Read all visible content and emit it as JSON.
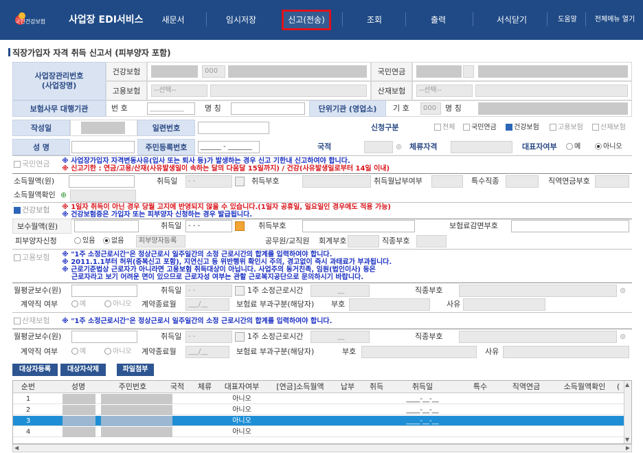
{
  "header": {
    "logo_text": "국민건강보험",
    "app_title": "사업장 EDI서비스",
    "nav": {
      "new_doc": "새문서",
      "temp_save": "임시저장",
      "submit": "신고(전송)",
      "lookup": "조회",
      "print": "출력",
      "close_form": "서식닫기",
      "help": "도움말",
      "all_menu": "전체메뉴 열기"
    }
  },
  "page": {
    "title": "직장가입자 자격 취득 신고서 (피부양자 포함)"
  },
  "form": {
    "biz_no_label": "사업장관리번호\n(사업장명)",
    "health_label": "건강보험",
    "employ_label": "고용보험",
    "pension_label": "국민연금",
    "accident_label": "산재보험",
    "code_000": "000",
    "select_placeholder": "--선택--",
    "agency_label": "보험사무 대행기관",
    "no_label": "번 호",
    "name_label": "명 칭",
    "agency_no_placeholder": "__________",
    "unit_label": "단위기관 (영업소)",
    "symbol_label": "기 호",
    "date_label": "작성일",
    "serial_label": "일련번호",
    "apply_label": "신청구분",
    "apply_all": "전체",
    "apply_pension": "국민연금",
    "apply_health": "건강보험",
    "apply_employ": "고용보험",
    "apply_accident": "산재보험",
    "person_name_label": "성 명",
    "rrn_label": "주민등록번호",
    "rrn_placeholder": "______ - _______",
    "nationality_label": "국적",
    "stay_label": "체류자격",
    "rep_label": "대표자여부",
    "yes": "예",
    "no": "아니오"
  },
  "pension": {
    "section_label": "국민연금",
    "warn1": "※ 사업장가입자 자격변동사유(입사 또는 퇴사 등)가 발생하는 경우 신고 기한내 신고하여야 합니다.",
    "warn2": "※ 신고기한 : 연금/고용/산재(사유발생일이 속하는 달의 다음달 15일까지) / 건강(사유발생일로부터 14일 이내)",
    "income_label": "소득월액(원)",
    "acq_date_label": "취득일",
    "acq_date_placeholder": "- -",
    "acq_code_label": "취득부호",
    "monthly_pay_label": "취득월납부여부",
    "special_label": "특수직종",
    "job_pension_label": "직역연금부호",
    "income_check_label": "소득월액확인"
  },
  "health": {
    "section_label": "건강보험",
    "warn1": "※ 1일자 취득이 아닌 경우 당월 고지에 반영되지 않을 수 있습니다.(1일자 공휴일, 일요일인 경우에도 적용 가능)",
    "warn2": "※ 건강보험증은 가입자 또는 피부양자 신청하는 경우 발급됩니다.",
    "pay_label": "보수월액(원)",
    "acq_date_label": "취득일",
    "acq_date_placeholder": "- - -",
    "acq_code_label": "취득부호",
    "reduce_label": "보험료감면부호",
    "dependent_label": "피부양자신청",
    "dep_yes": "있음",
    "dep_no": "없음",
    "dep_register": "피부양자등록",
    "official_label": "공무원/교직원",
    "account_label": "회계부호",
    "job_label": "직종부호"
  },
  "employ": {
    "section_label": "고용보험",
    "warn1": "※ \"1주 소정근로시간\"은 정상근로시 일주일간의 소정 근로시간의 합계를 입력하여야 합니다.",
    "warn2": "※ 2011.1.1부터 허위(중복신고 포함), 지연신고 등 위반행위 확인시 주의, 경고없이 즉시 과태료가 부과됩니다.",
    "warn3": "※ 근로기준법상 근로자가 아니라면 고용보험 취득대상이 아닙니다. 사업주의 동거친족, 임원(법인이사) 등은",
    "warn4": "근로자라고 보기 어려운 면이 있으므로 근로자성 여부는 관할 근로복지공단으로 문의하시기 바랍니다.",
    "avg_pay_label": "월평균보수(원)",
    "acq_date_label": "취득일",
    "acq_date_placeholder": "- -",
    "week_hours_label": "1주 소정근로시간",
    "week_hours_placeholder": "__",
    "job_label": "직종부호",
    "contract_label": "계약직 여부",
    "yes": "예",
    "no": "아니오",
    "contract_end_label": "계약종료월",
    "contract_end_placeholder": "___/__",
    "levy_label": "보험료 부과구분(해당자)",
    "code_label": "부호",
    "reason_label": "사유"
  },
  "accident": {
    "section_label": "산재보험",
    "warn1": "※ \"1주 소정근로시간\"은 정상근로시 일주일간의 소정 근로시간의 합계를 입력하여야 합니다.",
    "avg_pay_label": "월평균보수(원)",
    "acq_date_label": "취득일",
    "acq_date_placeholder": "- -",
    "week_hours_label": "1주 소정근로시간",
    "week_hours_placeholder": "__",
    "job_label": "직종부호",
    "contract_label": "계약직 여부",
    "yes": "예",
    "no": "아니오",
    "contract_end_label": "계약종료월",
    "contract_end_placeholder": "___/__",
    "levy_label": "보험료 부과구분(해당자)",
    "code_label": "부호",
    "reason_label": "사유"
  },
  "actions": {
    "add_target": "대상자등록",
    "delete_target": "대상자삭제",
    "attach_file": "파일첨부"
  },
  "grid": {
    "headers": [
      "순번",
      "성명",
      "주민번호",
      "국적",
      "체류",
      "대표자여부",
      "[연금]소득월액",
      "납부",
      "취득",
      "취득일",
      "특수",
      "직역연금",
      "소득월액확인",
      "("
    ],
    "rows": [
      {
        "no": "1",
        "rep": "아니오",
        "date": "____-__-__"
      },
      {
        "no": "2",
        "rep": "아니오",
        "date": "____-__-__"
      },
      {
        "no": "3",
        "rep": "아니오",
        "date": "____-__-__"
      },
      {
        "no": "4",
        "rep": "아니오",
        "date": ""
      }
    ]
  }
}
